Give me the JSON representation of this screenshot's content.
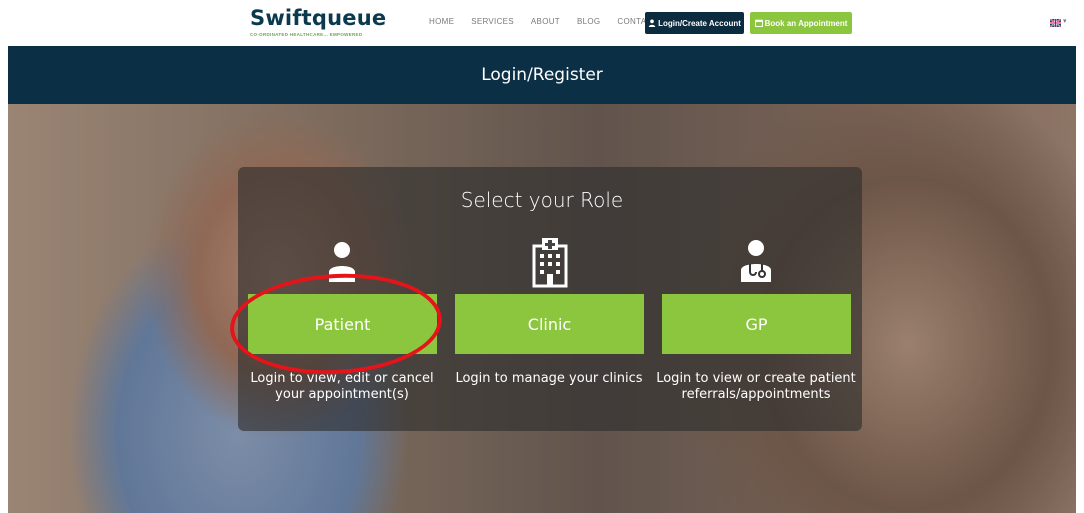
{
  "logo": {
    "name": "Swiftqueue",
    "tagline": "CO-ORDINATED HEALTHCARE... EMPOWERED"
  },
  "nav": {
    "items": [
      "HOME",
      "SERVICES",
      "ABOUT",
      "BLOG",
      "CONTACT"
    ]
  },
  "actions": {
    "login_label": "Login/Create Account",
    "book_label": "Book an Appointment"
  },
  "language": {
    "flag": "uk-flag-icon"
  },
  "page": {
    "header": "Login/Register"
  },
  "roles": {
    "title": "Select your Role",
    "items": [
      {
        "icon": "patient-user-icon",
        "label": "Patient",
        "description": "Login to view, edit or cancel your appointment(s)"
      },
      {
        "icon": "hospital-building-icon",
        "label": "Clinic",
        "description": "Login to manage your clinics"
      },
      {
        "icon": "doctor-stethoscope-icon",
        "label": "GP",
        "description": "Login to view or create patient referrals/appointments"
      }
    ]
  },
  "colors": {
    "navy": "#0b2f45",
    "green": "#8cc63f",
    "highlight": "#e4141a"
  }
}
